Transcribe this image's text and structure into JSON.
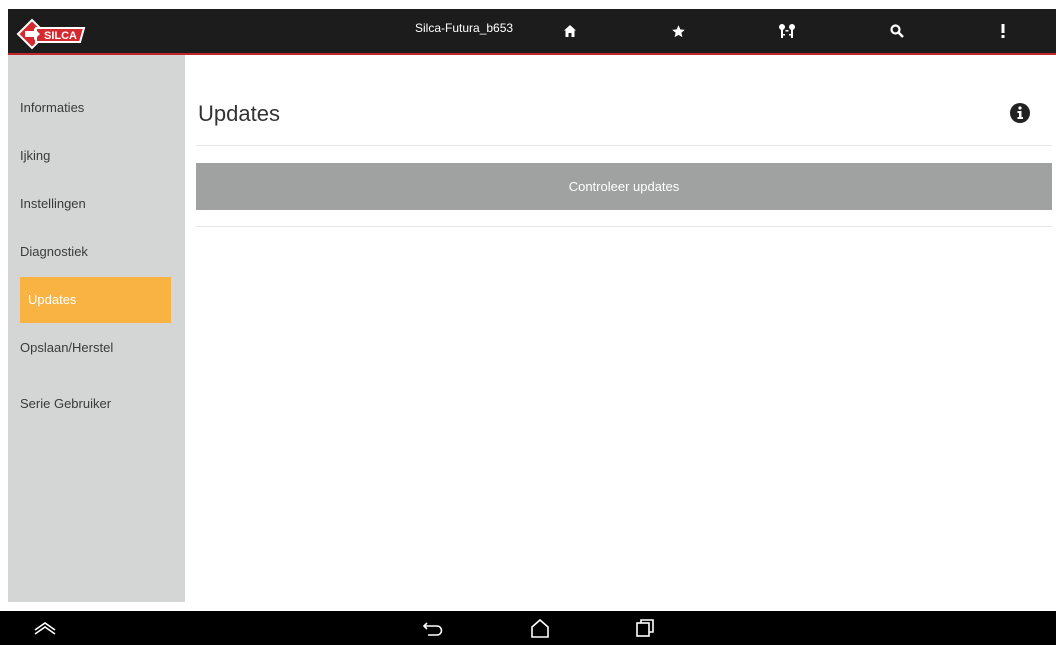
{
  "header": {
    "device_name": "Silca-Futura_b653",
    "icons": [
      "home-icon",
      "star-icon",
      "keys-icon",
      "search-icon",
      "overflow-menu-icon"
    ],
    "accent_color": "#c0262c"
  },
  "logo": {
    "text": "SILCA"
  },
  "sidebar": {
    "items": [
      {
        "label": "Informaties"
      },
      {
        "label": "Ijking"
      },
      {
        "label": "Instellingen"
      },
      {
        "label": "Diagnostiek"
      },
      {
        "label": "Updates",
        "active": true
      },
      {
        "label": "Opslaan/Herstel"
      },
      {
        "label": "Serie Gebruiker"
      }
    ],
    "active_color": "#f8b343"
  },
  "main": {
    "title": "Updates",
    "check_button_label": "Controleer updates"
  },
  "navbar": {
    "icons": [
      "collapse-icon",
      "back-icon",
      "home-icon",
      "recents-icon"
    ]
  }
}
